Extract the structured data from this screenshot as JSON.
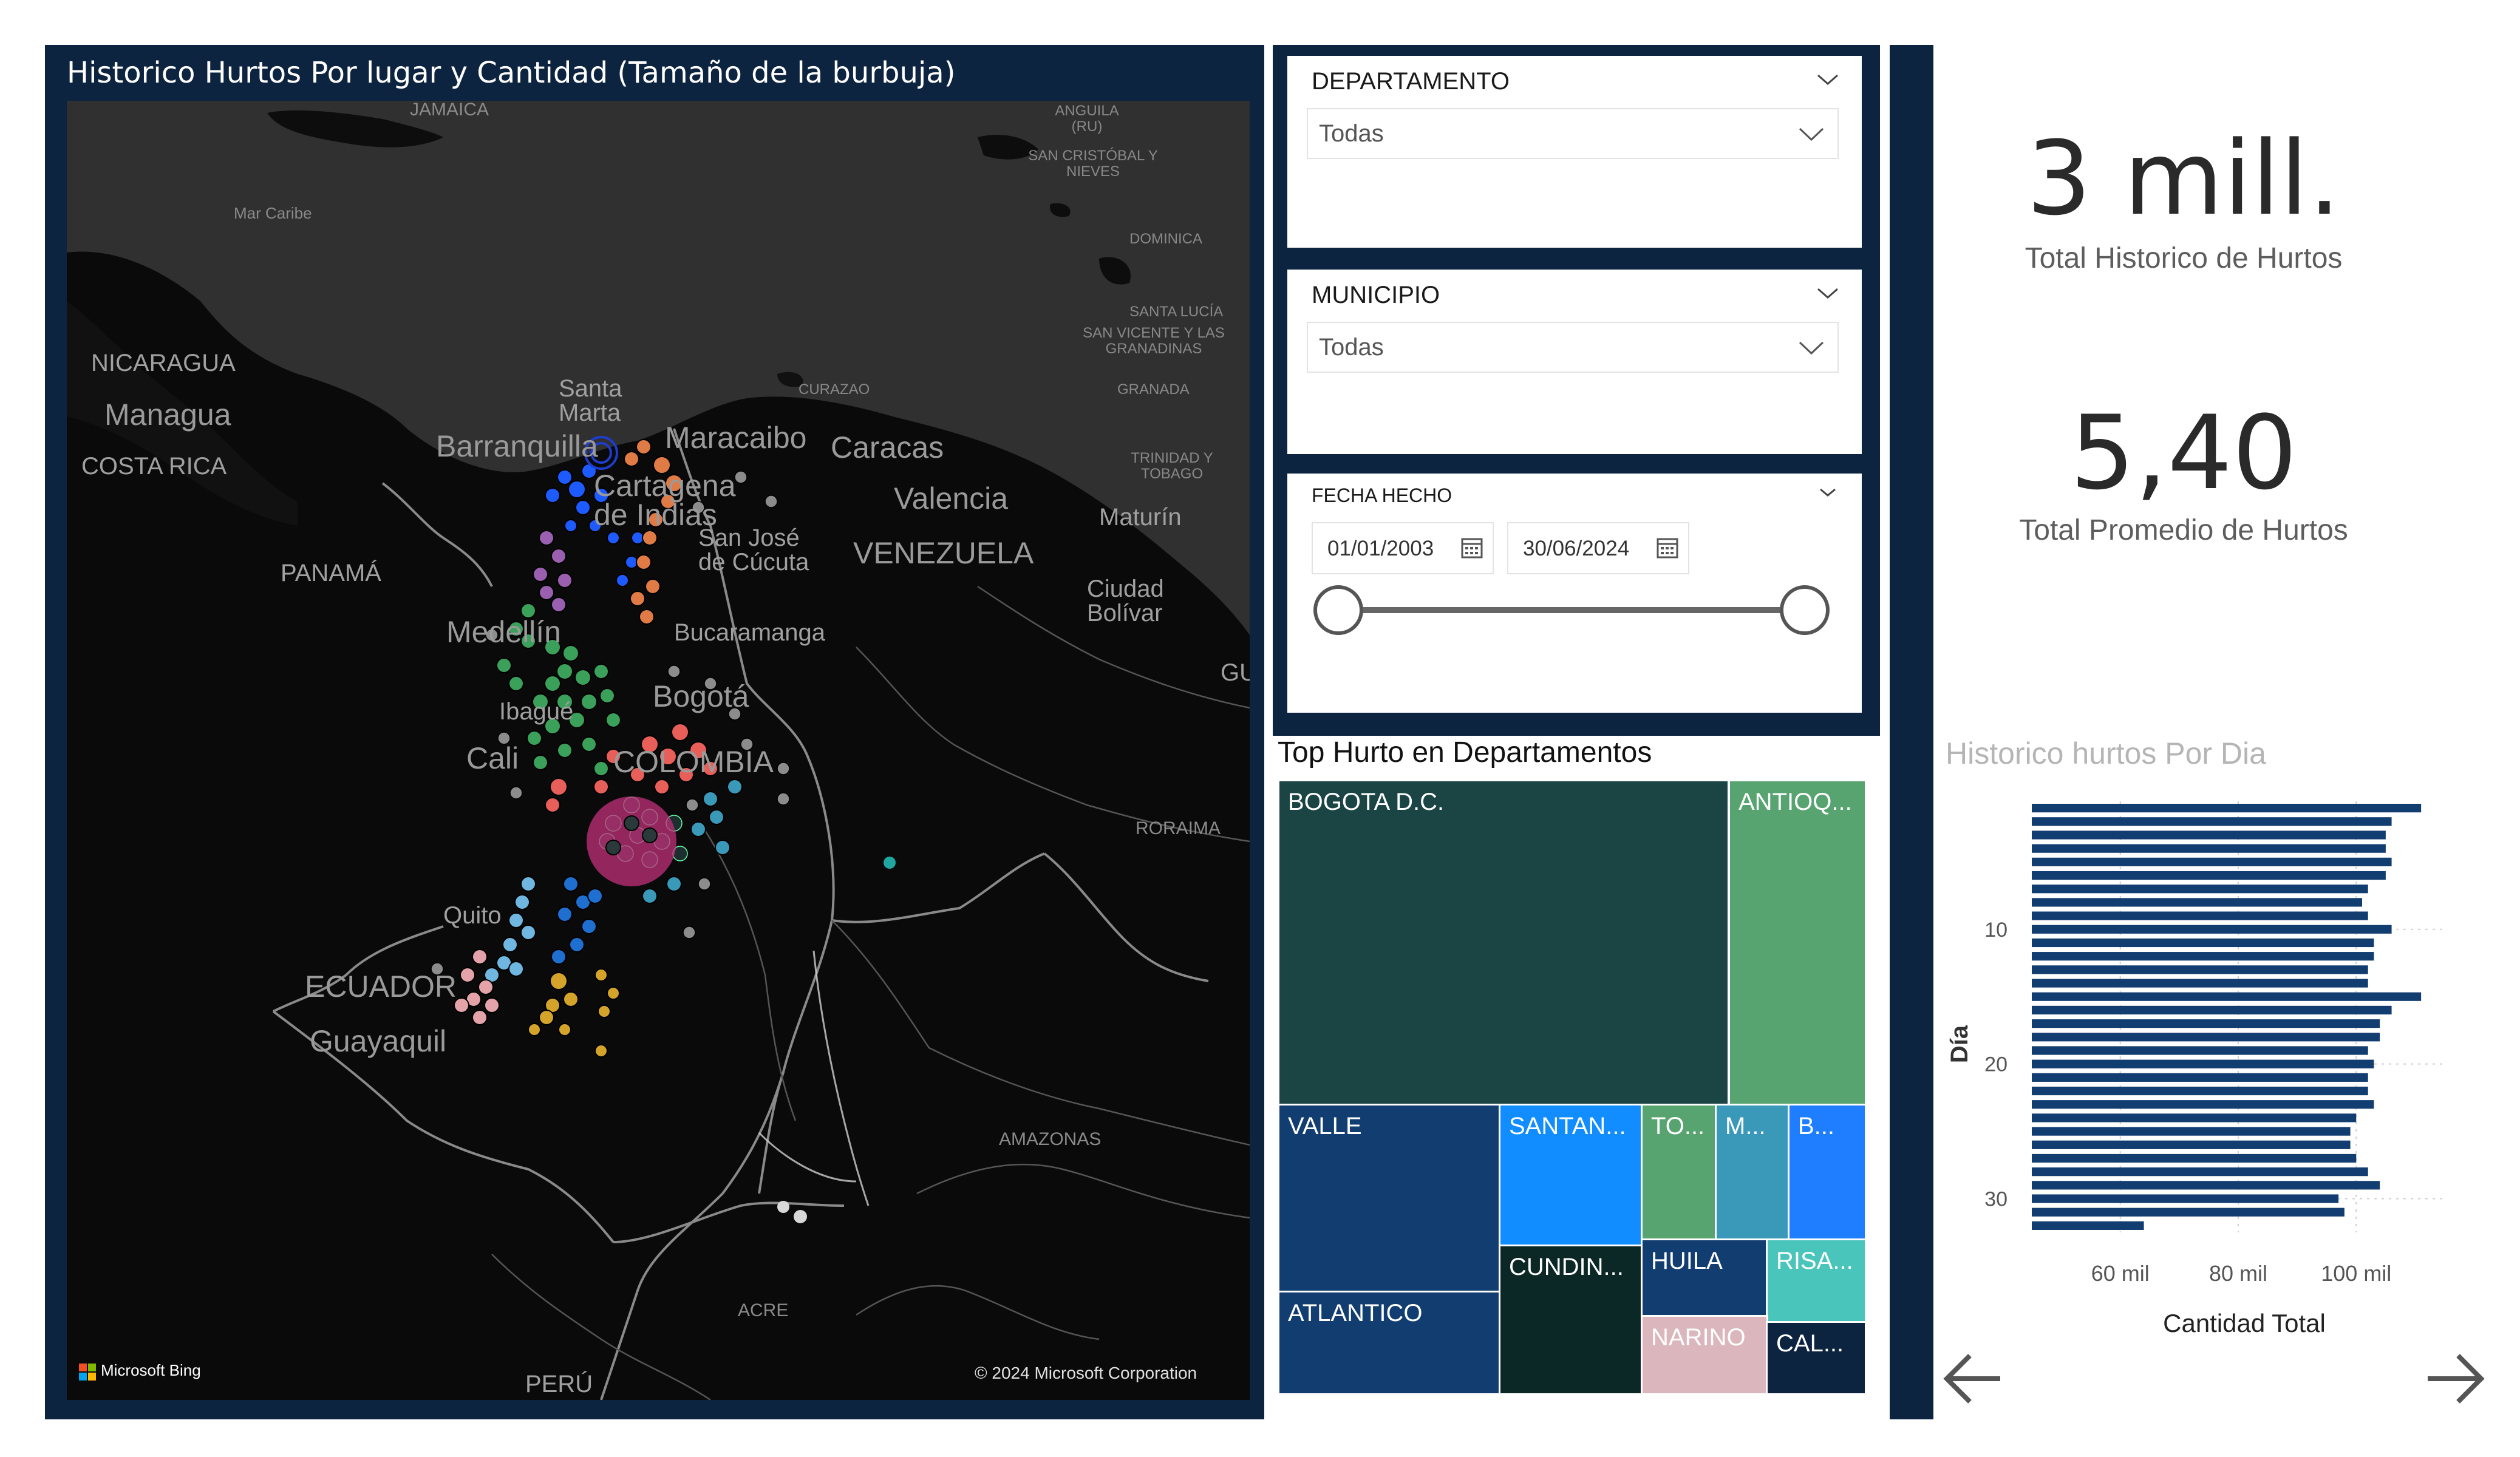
{
  "map": {
    "title": "Historico Hurtos Por lugar y Cantidad (Tamaño de la burbuja)",
    "labels": {
      "jamaica": "JAMAICA",
      "mar_caribe": "Mar Caribe",
      "nicaragua": "NICARAGUA",
      "managua": "Managua",
      "costa_rica": "COSTA RICA",
      "panama": "PANAMÁ",
      "santa_marta": "Santa Marta",
      "barranquilla": "Barranquilla",
      "maracaibo": "Maracaibo",
      "curazao": "CURAZAO",
      "caracas": "Caracas",
      "valencia": "Valencia",
      "cartagena": "Cartagena de Indias",
      "san_jose_cucuta": "San José de Cúcuta",
      "venezuela": "VENEZUELA",
      "maturin": "Maturín",
      "ciudad_bolivar": "Ciudad Bolívar",
      "medellin": "Medellín",
      "bucaramanga": "Bucaramanga",
      "ibague": "Ibagué",
      "bogota": "Bogotá",
      "cali": "Cali",
      "colombia": "COLOMBIA",
      "gu": "GU",
      "roraima": "RORAIMA",
      "quito": "Quito",
      "ecuador": "ECUADOR",
      "guayaquil": "Guayaquil",
      "amazonas": "AMAZONAS",
      "acre": "ACRE",
      "peru": "PERÚ",
      "anguila": "ANGUILA (RU)",
      "san_cristobal": "SAN CRISTÓBAL Y NIEVES",
      "dominica": "DOMINICA",
      "santa_lucia": "SANTA LUCÍA",
      "san_vicente": "SAN VICENTE Y LAS GRANADINAS",
      "granada": "GRANADA",
      "trinidad": "TRINIDAD Y TOBAGO"
    },
    "bing_logo": "Microsoft Bing",
    "copyright": "© 2024 Microsoft Corporation"
  },
  "slicers": {
    "departamento": {
      "label": "DEPARTAMENTO",
      "value": "Todas"
    },
    "municipio": {
      "label": "MUNICIPIO",
      "value": "Todas"
    },
    "fecha": {
      "label": "FECHA HECHO",
      "start": "01/01/2003",
      "end": "30/06/2024"
    }
  },
  "treemap": {
    "title": "Top Hurto en Departamentos",
    "items": [
      {
        "label": "BOGOTA D.C.",
        "color": "#1b4444"
      },
      {
        "label": "ANTIOQ...",
        "color": "#58a470"
      },
      {
        "label": "VALLE",
        "color": "#123d70"
      },
      {
        "label": "ATLANTICO",
        "color": "#123d70"
      },
      {
        "label": "SANTAN...",
        "color": "#118dff"
      },
      {
        "label": "CUNDIN...",
        "color": "#0b2726"
      },
      {
        "label": "TO...",
        "color": "#58a470"
      },
      {
        "label": "M...",
        "color": "#3a98b9"
      },
      {
        "label": "B...",
        "color": "#1e7eff"
      },
      {
        "label": "HUILA",
        "color": "#123d70"
      },
      {
        "label": "RISA...",
        "color": "#4ac5bb"
      },
      {
        "label": "NARINO",
        "color": "#dbb7bd"
      },
      {
        "label": "CAL...",
        "color": "#0d2440"
      }
    ]
  },
  "kpis": {
    "total": {
      "value": "3 mill.",
      "label": "Total Historico de Hurtos"
    },
    "promedio": {
      "value": "5,40",
      "label": "Total Promedio de Hurtos"
    }
  },
  "bar_chart": {
    "title": "Historico hurtos Por Dia",
    "ylabel": "Día",
    "xlabel": "Cantidad Total",
    "x_ticks": [
      "60 mil",
      "80 mil",
      "100 mil"
    ],
    "y_ticks": [
      "10",
      "20",
      "30"
    ],
    "bar_color": "#123d70"
  },
  "chart_data": {
    "type": "bar",
    "orientation": "horizontal",
    "title": "Historico hurtos Por Dia",
    "xlabel": "Cantidad Total",
    "ylabel": "Día",
    "xlim": [
      45000,
      115000
    ],
    "categories": [
      1,
      2,
      3,
      4,
      5,
      6,
      7,
      8,
      9,
      10,
      11,
      12,
      13,
      14,
      15,
      16,
      17,
      18,
      19,
      20,
      21,
      22,
      23,
      24,
      25,
      26,
      27,
      28,
      29,
      30,
      31
    ],
    "values": [
      111000,
      106000,
      105000,
      105000,
      106000,
      105000,
      102000,
      101000,
      102000,
      106000,
      103000,
      103000,
      102000,
      102000,
      111000,
      106000,
      104000,
      104000,
      102000,
      103000,
      102000,
      102000,
      103000,
      100000,
      99000,
      99000,
      100000,
      102000,
      104000,
      97000,
      98000,
      64000
    ]
  },
  "nav": {
    "back": "back-arrow",
    "forward": "forward-arrow"
  }
}
